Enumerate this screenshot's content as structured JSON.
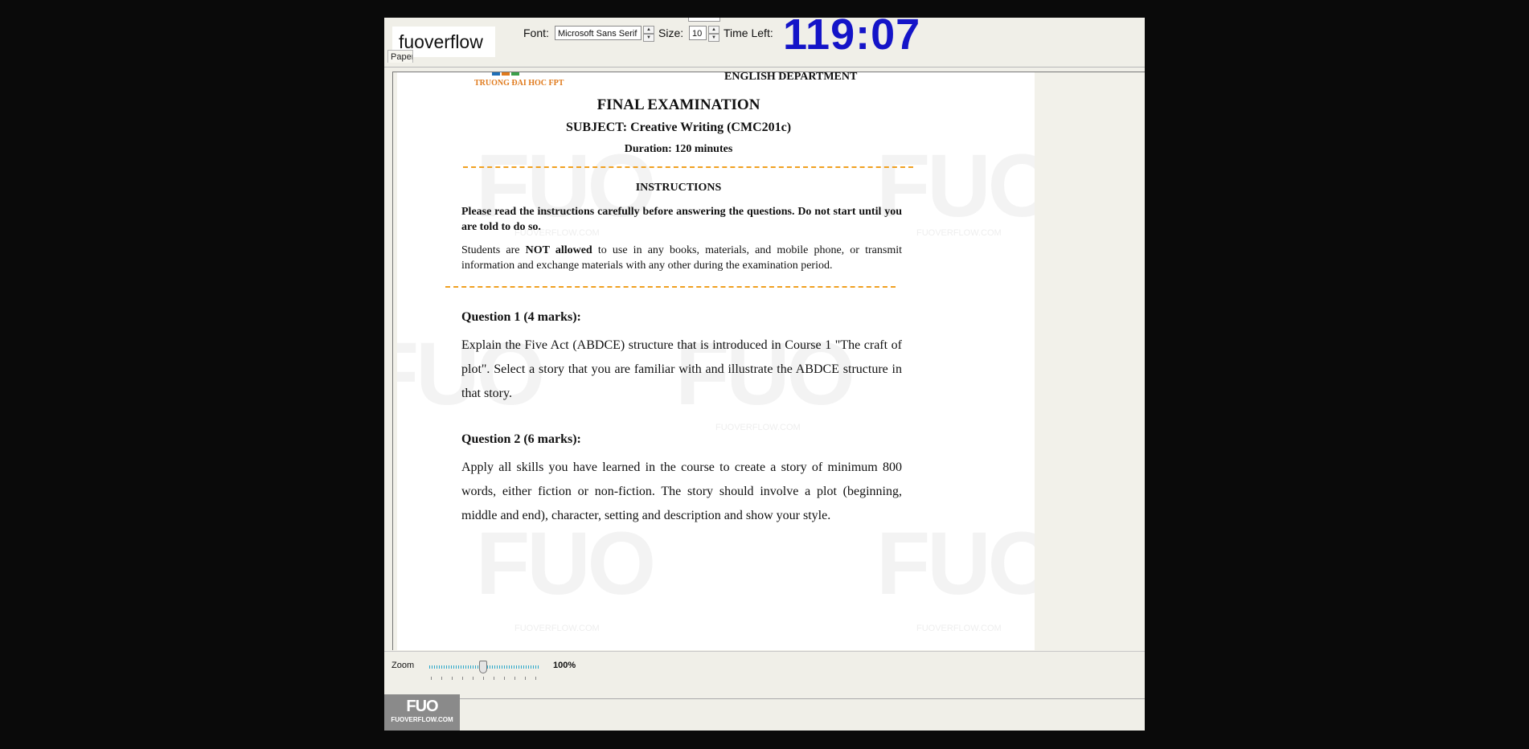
{
  "toolbar": {
    "brand": "fuoverflow",
    "font_label": "Font:",
    "font_value": "Microsoft Sans Serif",
    "size_label": "Size:",
    "size_value": "10",
    "time_label": "Time Left:",
    "time_value": "119:07"
  },
  "tab": {
    "label": "Paper"
  },
  "document": {
    "school": "TRUONG ĐAI HOC FPT",
    "department": "ENGLISH DEPARTMENT",
    "title": "FINAL EXAMINATION",
    "subject": "SUBJECT: Creative Writing (CMC201c)",
    "duration": "Duration: 120 minutes",
    "instructions_heading": "INSTRUCTIONS",
    "instruction_1": "Please read the instructions carefully before answering the questions. Do not start until you are told to do so.",
    "instruction_2_pre": "Students are ",
    "instruction_2_bold": "NOT allowed",
    "instruction_2_post": " to use in any books, materials, and mobile phone, or transmit information and exchange materials with any other during the examination period.",
    "q1_heading": "Question 1 (4 marks):",
    "q1_body": "Explain the Five Act (ABDCE) structure that is introduced in Course 1 \"The craft of plot\". Select a story that you are familiar with and illustrate the ABDCE structure in that story.",
    "q2_heading": "Question 2 (6 marks):",
    "q2_body": "Apply all skills you have learned in the course to create a story of minimum 800 words, either fiction or non-fiction. The story should involve a plot (beginning, middle and end), character, setting and description and show your style.",
    "watermark": "FUO",
    "watermark_site": "FUOVERFLOW.COM"
  },
  "zoom": {
    "label": "Zoom",
    "value": "100%",
    "level_percent": 100
  },
  "footer_logo": {
    "big": "FUO",
    "small": "FUOVERFLOW.COM"
  }
}
